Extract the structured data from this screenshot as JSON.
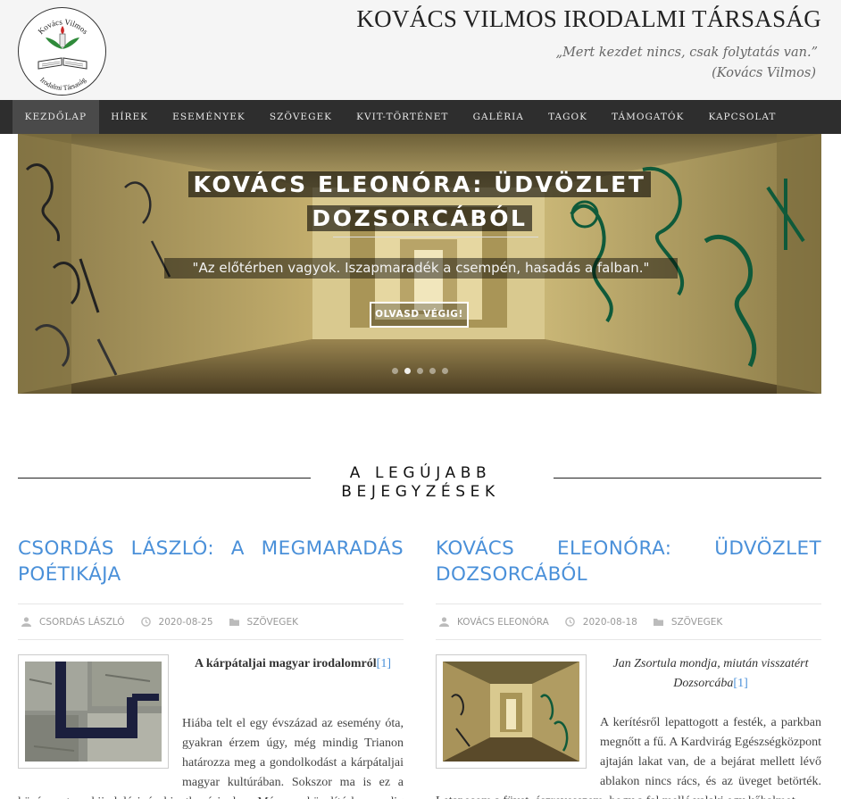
{
  "site": {
    "logo_text_top": "Kovács Vilmos",
    "logo_text_bottom": "Irodalmi Társaság",
    "title": "KOVÁCS VILMOS IRODALMI TÁRSASÁG",
    "motto_line1": "„Mert kezdet nincs, csak folytatás van.”",
    "motto_line2": "(Kovács Vilmos)"
  },
  "nav": {
    "items": [
      {
        "label": "KEZDŐLAP",
        "active": true
      },
      {
        "label": "HÍREK"
      },
      {
        "label": "ESEMÉNYEK"
      },
      {
        "label": "SZÖVEGEK"
      },
      {
        "label": "KVIT-TÖRTÉNET"
      },
      {
        "label": "GALÉRIA"
      },
      {
        "label": "TAGOK"
      },
      {
        "label": "TÁMOGATÓK"
      },
      {
        "label": "KAPCSOLAT"
      }
    ]
  },
  "slider": {
    "title": "KOVÁCS ELEONÓRA: ÜDVÖZLET DOZSORCÁBÓL",
    "quote": "\"Az előtérben vagyok. Iszapmaradék a csempén, hasadás a falban.\"",
    "button": "OLVASD VÉGIG!",
    "slide_count": 5,
    "active_slide": 2
  },
  "section": {
    "title": "A LEGÚJABB BEJEGYZÉSEK"
  },
  "posts": [
    {
      "title": "CSORDÁS LÁSZLÓ: A MEGMARADÁS",
      "title_last": "POÉTIKÁJA",
      "author": "CSORDÁS LÁSZLÓ",
      "date": "2020-08-25",
      "category": "SZÖVEGEK",
      "subtitle": "A kárpátaljai magyar irodalomról",
      "footnote": "[1]",
      "text": "Hiába telt el egy évszázad az esemény óta, gyakran érzem úgy, még mindig Trianon határozza meg a gondolkodást a kárpátaljai magyar kultúrában. Sokszor ma is ez a középpont, a kiindulási és hivatkozási alap. Más megközelítésben pedig olyan ősbűn, amelyhez"
    },
    {
      "title": "KOVÁCS ELEONÓRA: ÜDVÖZLET",
      "title_last": "DOZSORCÁBÓL",
      "author": "KOVÁCS ELEONÓRA",
      "date": "2020-08-18",
      "category": "SZÖVEGEK",
      "subtitle": "Jan Zsortula mondja, miután visszatért Dozsorcába",
      "footnote": "[1]",
      "text": "A kerítésről lepattogott a festék, a parkban megnőtt a fű. A Kardvirág Egészségközpont ajtaján lakat van, de a bejárat mellett lévő ablakon nincs rács, és az üveget betörték. Letaposom a füvet, észrevesszem, hogy a fal mellé valaki egy kőhalmot"
    }
  ],
  "colors": {
    "accent": "#4a90d9",
    "nav_bg": "#2e2e2e",
    "header_bg": "#f5f5f5"
  }
}
